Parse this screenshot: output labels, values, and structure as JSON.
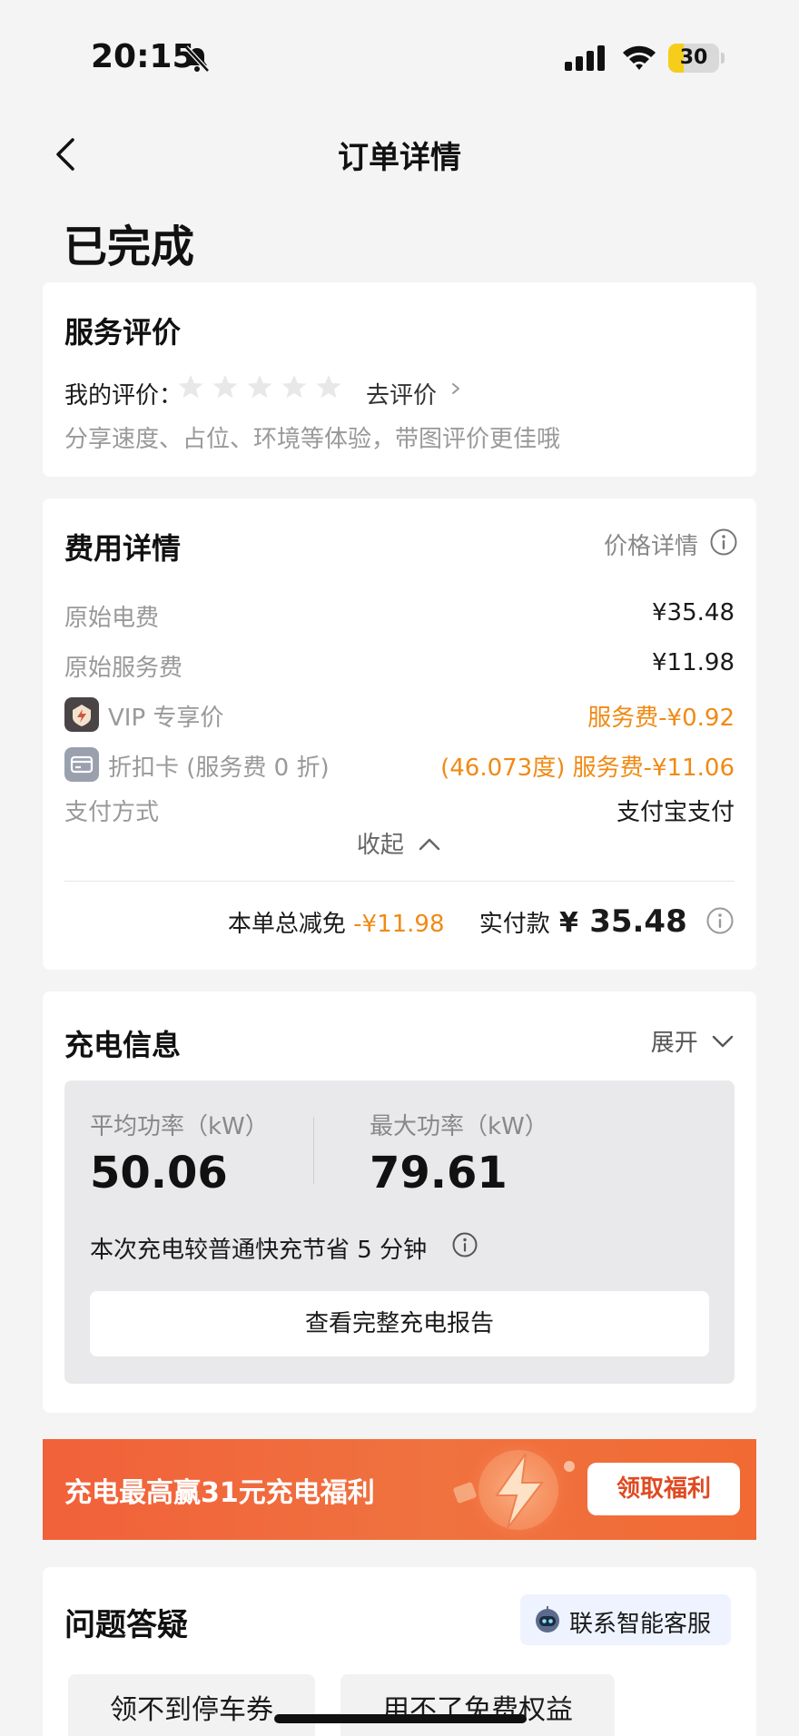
{
  "status_bar": {
    "time": "20:15",
    "battery": "30",
    "battery_level": 0.3,
    "icons": [
      "bell-slash-icon",
      "cellular-signal-icon",
      "wifi-icon",
      "battery-icon"
    ]
  },
  "nav": {
    "title": "订单详情",
    "back_icon": "chevron-left-icon"
  },
  "order_status": "已完成",
  "rating": {
    "title": "服务评价",
    "my_rating_label": "我的评价：",
    "stars_total": 5,
    "stars_filled": 0,
    "go_rate_label": "去评价",
    "hint": "分享速度、占位、环境等体验，带图评价更佳哦"
  },
  "fee": {
    "title": "费用详情",
    "price_detail_label": "价格详情",
    "rows": [
      {
        "label": "原始电费",
        "value": "¥35.48"
      },
      {
        "label": "原始服务费",
        "value": "¥11.98"
      },
      {
        "label": "VIP 专享价",
        "value": "服务费-¥0.92"
      },
      {
        "label": "折扣卡 (服务费 0 折)",
        "value": "(46.073度) 服务费-¥11.06"
      },
      {
        "label": "支付方式",
        "value": "支付宝支付"
      }
    ],
    "collapse_label": "收起",
    "total_discount_label": "本单总减免",
    "total_discount_value": "-¥11.98",
    "paid_label": "实付款",
    "paid_currency": "¥",
    "paid_amount": "35.48"
  },
  "charging": {
    "title": "充电信息",
    "expand_label": "展开",
    "avg_power_label": "平均功率（kW）",
    "avg_power_value": "50.06",
    "max_power_label": "最大功率（kW）",
    "max_power_value": "79.61",
    "save_note": "本次充电较普通快充节省 5 分钟",
    "report_button": "查看完整充电报告"
  },
  "promo": {
    "text": "充电最高赢31元充电福利",
    "button": "领取福利"
  },
  "faq": {
    "title": "问题答疑",
    "customer_service": "联系智能客服",
    "chips": [
      "领不到停车券",
      "用不了免费权益"
    ]
  },
  "colors": {
    "accent_orange": "#f08a14",
    "promo_red": "#f1613a",
    "battery_yellow": "#f6cd1b"
  }
}
